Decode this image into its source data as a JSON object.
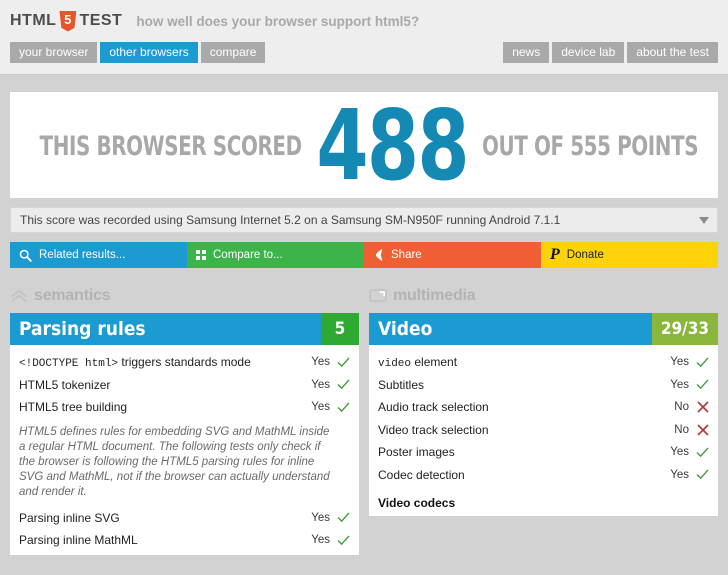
{
  "header": {
    "logo": {
      "html": "HTML",
      "five": "5",
      "test": "TEST"
    },
    "tagline": "how well does your browser support html5?",
    "nav_left": [
      {
        "label": "your browser",
        "active": false
      },
      {
        "label": "other browsers",
        "active": true
      },
      {
        "label": "compare",
        "active": false
      }
    ],
    "nav_right": [
      {
        "label": "news"
      },
      {
        "label": "device lab"
      },
      {
        "label": "about the test"
      }
    ]
  },
  "score": {
    "prefix": "THIS BROWSER SCORED",
    "value": "488",
    "suffix": "OUT OF 555 POINTS",
    "color": "#1489b4"
  },
  "info": {
    "text": "This score was recorded using Samsung Internet 5.2 on a Samsung SM-N950F running Android 7.1.1"
  },
  "actions": [
    {
      "label": "Related results...",
      "icon": "search-icon",
      "color": "#1b9bd1"
    },
    {
      "label": "Compare to...",
      "icon": "grid-icon",
      "color": "#3cb44a"
    },
    {
      "label": "Share",
      "icon": "share-icon",
      "color": "#ef5f33"
    },
    {
      "label": "Donate",
      "icon": "paypal-icon",
      "color": "#fdd209"
    }
  ],
  "categories": [
    {
      "name": "semantics",
      "icon": "chevrons-up-icon",
      "panel": {
        "title": "Parsing rules",
        "score": "5",
        "score_state": "full",
        "items": [
          {
            "type": "test",
            "name": "<!DOCTYPE html> triggers standards mode",
            "mono_prefix": "<!DOCTYPE html>",
            "rest": " triggers standards mode",
            "value": "Yes",
            "pass": true
          },
          {
            "type": "test",
            "name": "HTML5 tokenizer",
            "value": "Yes",
            "pass": true
          },
          {
            "type": "test",
            "name": "HTML5 tree building",
            "value": "Yes",
            "pass": true
          },
          {
            "type": "note",
            "text": "HTML5 defines rules for embedding SVG and MathML inside a regular HTML document. The following tests only check if the browser is following the HTML5 parsing rules for inline SVG and MathML, not if the browser can actually understand and render it."
          },
          {
            "type": "test",
            "name": "Parsing inline SVG",
            "value": "Yes",
            "pass": true
          },
          {
            "type": "test",
            "name": "Parsing inline MathML",
            "value": "Yes",
            "pass": true
          }
        ]
      }
    },
    {
      "name": "multimedia",
      "icon": "screen-icon",
      "panel": {
        "title": "Video",
        "score": "29/33",
        "score_state": "partial",
        "items": [
          {
            "type": "test",
            "name": "video element",
            "mono_prefix": "video",
            "rest": " element",
            "value": "Yes",
            "pass": true
          },
          {
            "type": "test",
            "name": "Subtitles",
            "value": "Yes",
            "pass": true
          },
          {
            "type": "test",
            "name": "Audio track selection",
            "value": "No",
            "pass": false
          },
          {
            "type": "test",
            "name": "Video track selection",
            "value": "No",
            "pass": false
          },
          {
            "type": "test",
            "name": "Poster images",
            "value": "Yes",
            "pass": true
          },
          {
            "type": "test",
            "name": "Codec detection",
            "value": "Yes",
            "pass": true
          },
          {
            "type": "subhead",
            "text": "Video codecs"
          }
        ]
      }
    }
  ]
}
